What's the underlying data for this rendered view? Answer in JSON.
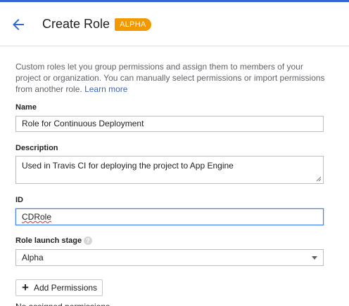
{
  "header": {
    "title": "Create Role",
    "badge": "ALPHA"
  },
  "intro": {
    "text": "Custom roles let you group permissions and assign them to members of your project or organization. You can manually select permissions or import permissions from another role.",
    "link": "Learn more"
  },
  "form": {
    "name_label": "Name",
    "name_value": "Role for Continuous Deployment",
    "description_label": "Description",
    "description_value": "Used in Travis CI for deploying the project to App Engine",
    "id_label": "ID",
    "id_value": "CDRole",
    "stage_label": "Role launch stage",
    "stage_value": "Alpha",
    "add_permissions_label": "Add Permissions",
    "partial_text": "No assigned permissions"
  },
  "colors": {
    "accent": "#3367d6",
    "badge": "#f29900",
    "focus": "#4285f4"
  },
  "icons": {
    "back": "arrow-left-icon",
    "help": "help-circle-icon",
    "dropdown": "caret-down-icon",
    "add": "plus-icon"
  }
}
